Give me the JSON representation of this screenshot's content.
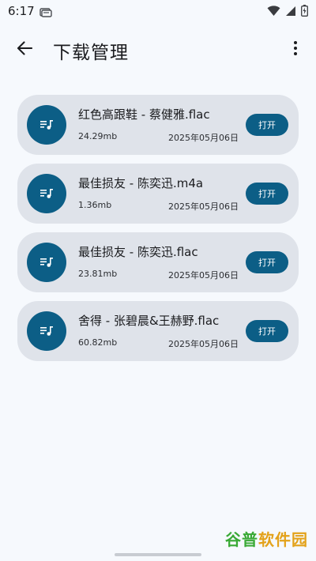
{
  "status_bar": {
    "time": "6:17",
    "icons": [
      "notification-card-icon",
      "wifi-icon",
      "signal-icon",
      "battery-icon"
    ]
  },
  "app_bar": {
    "title": "下载管理",
    "icons": [
      "back-arrow-icon",
      "more-vertical-icon"
    ]
  },
  "downloads": [
    {
      "name": "红色高跟鞋 - 蔡健雅.flac",
      "size": "24.29mb",
      "date": "2025年05月06日",
      "button": "打开"
    },
    {
      "name": "最佳损友 - 陈奕迅.m4a",
      "size": "1.36mb",
      "date": "2025年05月06日",
      "button": "打开"
    },
    {
      "name": "最佳损友 - 陈奕迅.flac",
      "size": "23.81mb",
      "date": "2025年05月06日",
      "button": "打开"
    },
    {
      "name": "舍得 - 张碧晨&王赫野.flac",
      "size": "60.82mb",
      "date": "2025年05月06日",
      "button": "打开"
    }
  ],
  "item_icon": "music-file-icon",
  "watermark": {
    "part_a": "谷普",
    "part_b": "软件园"
  },
  "colors": {
    "accent": "#0c5e86",
    "card_bg": "#dfe3ea",
    "page_bg": "#f6f9fd"
  }
}
